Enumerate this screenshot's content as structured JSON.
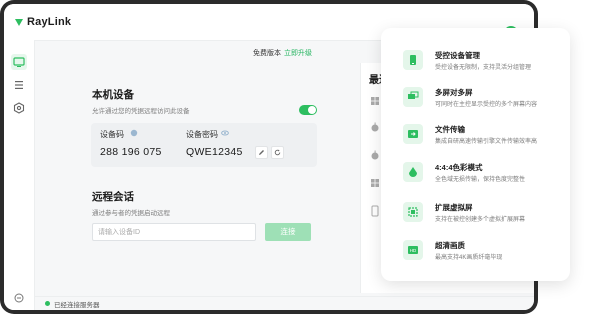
{
  "app": {
    "brand": "RayLink",
    "avatar_letter": "R",
    "accent": "#2dbe60"
  },
  "topbar": {
    "edition_label": "免费版本",
    "upgrade_link": "立即升级"
  },
  "sidebar": {
    "items": [
      {
        "icon": "monitor-icon",
        "active": true
      },
      {
        "icon": "list-icon",
        "active": false
      },
      {
        "icon": "settings-icon",
        "active": false
      }
    ],
    "bottom_icon": "help-icon"
  },
  "local_device": {
    "title": "本机设备",
    "subtitle": "允许通过您的凭据远程访问此设备",
    "toggle_on": true,
    "code_label": "设备码",
    "code_value": "288 196 075",
    "password_label": "设备密码",
    "password_value": "QWE12345"
  },
  "remote": {
    "title": "远程会话",
    "subtitle": "通过参与者的凭据启动远程",
    "input_placeholder": "请输入设备ID",
    "connect_label": "连接"
  },
  "recent": {
    "title": "最近",
    "items": [
      "windows-icon",
      "apple-icon",
      "apple-icon",
      "windows-icon",
      "tablet-icon"
    ]
  },
  "status": {
    "text": "已经连接服务器"
  },
  "features": [
    {
      "icon": "tablet-icon",
      "title": "受控设备管理",
      "desc": "受控设备无限制，支持灵活分组管理"
    },
    {
      "icon": "multi-screen-icon",
      "title": "多屏对多屏",
      "desc": "可同时在主控显示受控的多个屏幕内容"
    },
    {
      "icon": "file-transfer-icon",
      "title": "文件传输",
      "desc": "集成自研高速传输引擎文件传输效率高"
    },
    {
      "icon": "color-drop-icon",
      "title": "4:4:4色彩模式",
      "desc": "全色域无损传输，保持色度完整性"
    },
    {
      "icon": "virtual-screen-icon",
      "title": "扩展虚拟屏",
      "desc": "支持在被控创建多个虚拟扩展屏幕"
    },
    {
      "icon": "hd-icon",
      "title": "超清画质",
      "desc": "最高支持4K画质纤毫毕现"
    }
  ]
}
